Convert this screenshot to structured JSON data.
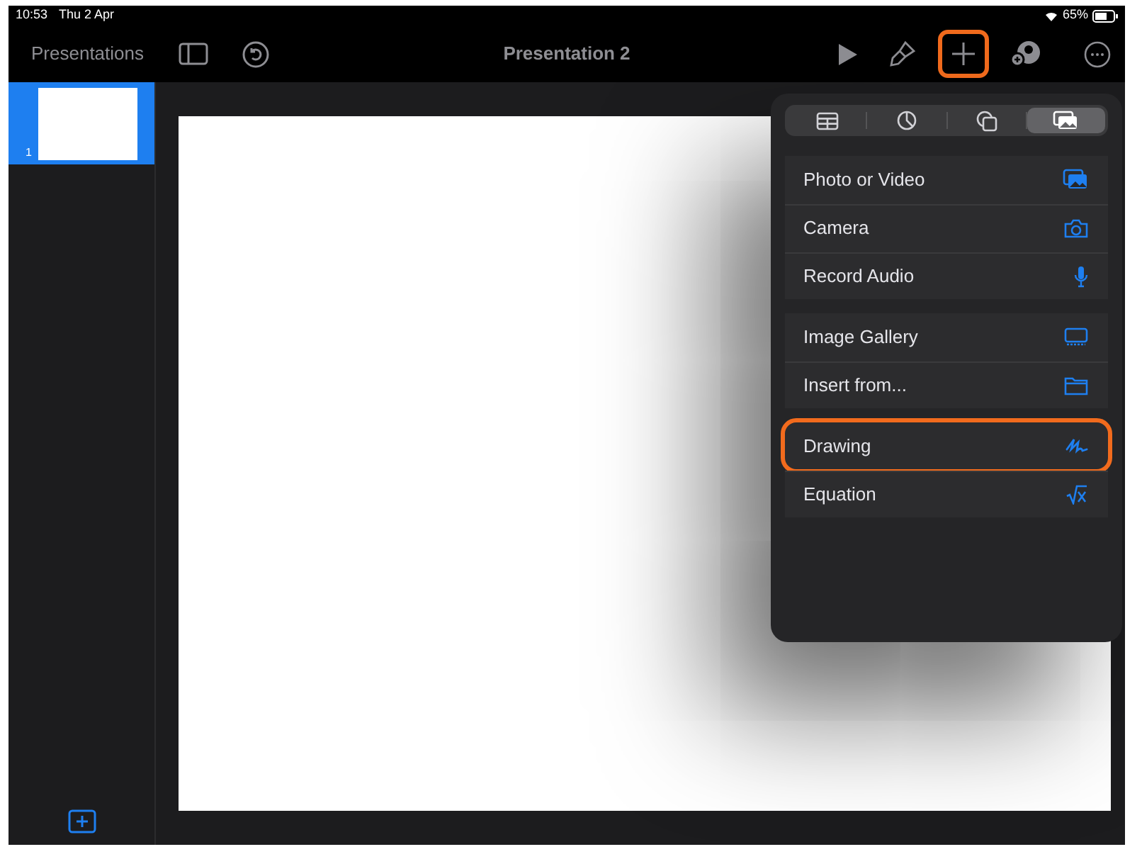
{
  "status_bar": {
    "time": "10:53",
    "date": "Thu 2 Apr",
    "battery": "65%"
  },
  "toolbar": {
    "back": "Presentations",
    "title": "Presentation 2",
    "add_highlighted": true
  },
  "slides": [
    {
      "number": "1",
      "selected": true
    }
  ],
  "insert_popover": {
    "tabs": [
      {
        "kind": "table",
        "selected": false
      },
      {
        "kind": "chart",
        "selected": false
      },
      {
        "kind": "shape",
        "selected": false
      },
      {
        "kind": "media",
        "selected": true
      }
    ],
    "groups": [
      [
        {
          "label": "Photo or Video",
          "kind": "photo",
          "highlighted": false
        },
        {
          "label": "Camera",
          "kind": "camera",
          "highlighted": false
        },
        {
          "label": "Record Audio",
          "kind": "mic",
          "highlighted": false
        }
      ],
      [
        {
          "label": "Image Gallery",
          "kind": "gallery",
          "highlighted": false
        },
        {
          "label": "Insert from...",
          "kind": "folder",
          "highlighted": false
        }
      ],
      [
        {
          "label": "Drawing",
          "kind": "drawing",
          "highlighted": true
        },
        {
          "label": "Equation",
          "kind": "equation",
          "highlighted": false
        }
      ]
    ]
  }
}
